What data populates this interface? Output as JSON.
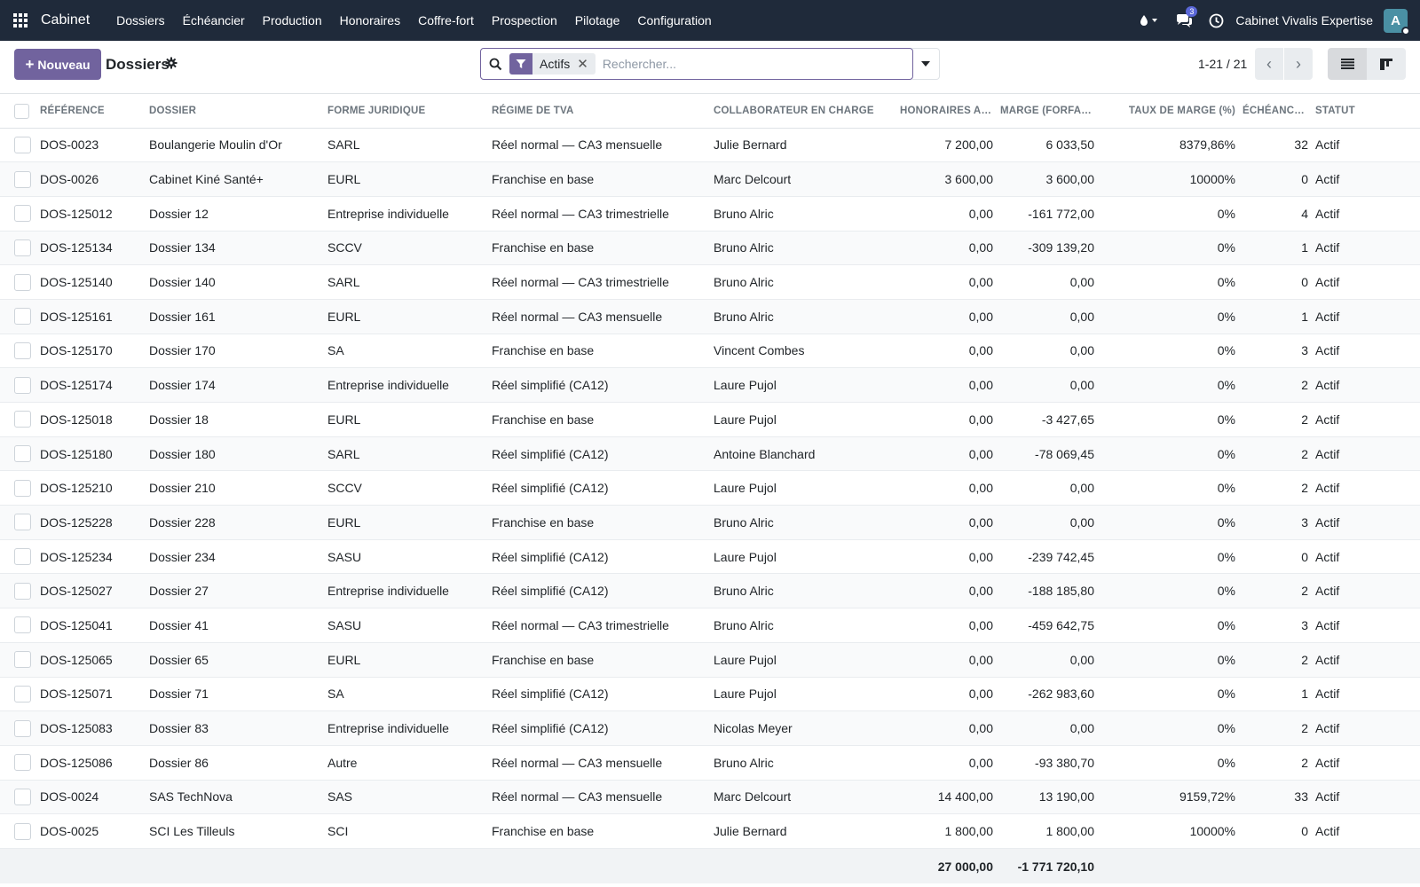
{
  "navbar": {
    "brand": "Cabinet",
    "menu": [
      "Dossiers",
      "Échéancier",
      "Production",
      "Honoraires",
      "Coffre-fort",
      "Prospection",
      "Pilotage",
      "Configuration"
    ],
    "messages_count": "3",
    "company": "Cabinet Vivalis Expertise",
    "avatar_letter": "A"
  },
  "control": {
    "new_label": "Nouveau",
    "title": "Dossiers",
    "facet_label": "Actifs",
    "search_placeholder": "Rechercher...",
    "pager": "1-21 / 21"
  },
  "table": {
    "headers": {
      "ref": "Référence",
      "dossier": "Dossier",
      "forme": "Forme juridique",
      "regime": "Régime de TVA",
      "collab": "Collaborateur en charge",
      "honoraires": "Honoraires an...",
      "marge": "Marge (forfait...",
      "taux": "Taux de marge (%)",
      "echeances": "Échéance...",
      "statut": "Statut"
    },
    "rows": [
      {
        "ref": "DOS-0023",
        "dossier": "Boulangerie Moulin d'Or",
        "forme": "SARL",
        "regime": "Réel normal — CA3 mensuelle",
        "collab": "Julie Bernard",
        "honoraires": "7 200,00",
        "marge": "6 033,50",
        "taux": "8379,86%",
        "echeances": "32",
        "statut": "Actif"
      },
      {
        "ref": "DOS-0026",
        "dossier": "Cabinet Kiné Santé+",
        "forme": "EURL",
        "regime": "Franchise en base",
        "collab": "Marc Delcourt",
        "honoraires": "3 600,00",
        "marge": "3 600,00",
        "taux": "10000%",
        "echeances": "0",
        "statut": "Actif"
      },
      {
        "ref": "DOS-125012",
        "dossier": "Dossier 12",
        "forme": "Entreprise individuelle",
        "regime": "Réel normal — CA3 trimestrielle",
        "collab": "Bruno Alric",
        "honoraires": "0,00",
        "marge": "-161 772,00",
        "taux": "0%",
        "echeances": "4",
        "statut": "Actif"
      },
      {
        "ref": "DOS-125134",
        "dossier": "Dossier 134",
        "forme": "SCCV",
        "regime": "Franchise en base",
        "collab": "Bruno Alric",
        "honoraires": "0,00",
        "marge": "-309 139,20",
        "taux": "0%",
        "echeances": "1",
        "statut": "Actif"
      },
      {
        "ref": "DOS-125140",
        "dossier": "Dossier 140",
        "forme": "SARL",
        "regime": "Réel normal — CA3 trimestrielle",
        "collab": "Bruno Alric",
        "honoraires": "0,00",
        "marge": "0,00",
        "taux": "0%",
        "echeances": "0",
        "statut": "Actif"
      },
      {
        "ref": "DOS-125161",
        "dossier": "Dossier 161",
        "forme": "EURL",
        "regime": "Réel normal — CA3 mensuelle",
        "collab": "Bruno Alric",
        "honoraires": "0,00",
        "marge": "0,00",
        "taux": "0%",
        "echeances": "1",
        "statut": "Actif"
      },
      {
        "ref": "DOS-125170",
        "dossier": "Dossier 170",
        "forme": "SA",
        "regime": "Franchise en base",
        "collab": "Vincent Combes",
        "honoraires": "0,00",
        "marge": "0,00",
        "taux": "0%",
        "echeances": "3",
        "statut": "Actif"
      },
      {
        "ref": "DOS-125174",
        "dossier": "Dossier 174",
        "forme": "Entreprise individuelle",
        "regime": "Réel simplifié (CA12)",
        "collab": "Laure Pujol",
        "honoraires": "0,00",
        "marge": "0,00",
        "taux": "0%",
        "echeances": "2",
        "statut": "Actif"
      },
      {
        "ref": "DOS-125018",
        "dossier": "Dossier 18",
        "forme": "EURL",
        "regime": "Franchise en base",
        "collab": "Laure Pujol",
        "honoraires": "0,00",
        "marge": "-3 427,65",
        "taux": "0%",
        "echeances": "2",
        "statut": "Actif"
      },
      {
        "ref": "DOS-125180",
        "dossier": "Dossier 180",
        "forme": "SARL",
        "regime": "Réel simplifié (CA12)",
        "collab": "Antoine Blanchard",
        "honoraires": "0,00",
        "marge": "-78 069,45",
        "taux": "0%",
        "echeances": "2",
        "statut": "Actif"
      },
      {
        "ref": "DOS-125210",
        "dossier": "Dossier 210",
        "forme": "SCCV",
        "regime": "Réel simplifié (CA12)",
        "collab": "Laure Pujol",
        "honoraires": "0,00",
        "marge": "0,00",
        "taux": "0%",
        "echeances": "2",
        "statut": "Actif"
      },
      {
        "ref": "DOS-125228",
        "dossier": "Dossier 228",
        "forme": "EURL",
        "regime": "Franchise en base",
        "collab": "Bruno Alric",
        "honoraires": "0,00",
        "marge": "0,00",
        "taux": "0%",
        "echeances": "3",
        "statut": "Actif"
      },
      {
        "ref": "DOS-125234",
        "dossier": "Dossier 234",
        "forme": "SASU",
        "regime": "Réel simplifié (CA12)",
        "collab": "Laure Pujol",
        "honoraires": "0,00",
        "marge": "-239 742,45",
        "taux": "0%",
        "echeances": "0",
        "statut": "Actif"
      },
      {
        "ref": "DOS-125027",
        "dossier": "Dossier 27",
        "forme": "Entreprise individuelle",
        "regime": "Réel simplifié (CA12)",
        "collab": "Bruno Alric",
        "honoraires": "0,00",
        "marge": "-188 185,80",
        "taux": "0%",
        "echeances": "2",
        "statut": "Actif"
      },
      {
        "ref": "DOS-125041",
        "dossier": "Dossier 41",
        "forme": "SASU",
        "regime": "Réel normal — CA3 trimestrielle",
        "collab": "Bruno Alric",
        "honoraires": "0,00",
        "marge": "-459 642,75",
        "taux": "0%",
        "echeances": "3",
        "statut": "Actif"
      },
      {
        "ref": "DOS-125065",
        "dossier": "Dossier 65",
        "forme": "EURL",
        "regime": "Franchise en base",
        "collab": "Laure Pujol",
        "honoraires": "0,00",
        "marge": "0,00",
        "taux": "0%",
        "echeances": "2",
        "statut": "Actif"
      },
      {
        "ref": "DOS-125071",
        "dossier": "Dossier 71",
        "forme": "SA",
        "regime": "Réel simplifié (CA12)",
        "collab": "Laure Pujol",
        "honoraires": "0,00",
        "marge": "-262 983,60",
        "taux": "0%",
        "echeances": "1",
        "statut": "Actif"
      },
      {
        "ref": "DOS-125083",
        "dossier": "Dossier 83",
        "forme": "Entreprise individuelle",
        "regime": "Réel simplifié (CA12)",
        "collab": "Nicolas Meyer",
        "honoraires": "0,00",
        "marge": "0,00",
        "taux": "0%",
        "echeances": "2",
        "statut": "Actif"
      },
      {
        "ref": "DOS-125086",
        "dossier": "Dossier 86",
        "forme": "Autre",
        "regime": "Réel normal — CA3 mensuelle",
        "collab": "Bruno Alric",
        "honoraires": "0,00",
        "marge": "-93 380,70",
        "taux": "0%",
        "echeances": "2",
        "statut": "Actif"
      },
      {
        "ref": "DOS-0024",
        "dossier": "SAS TechNova",
        "forme": "SAS",
        "regime": "Réel normal — CA3 mensuelle",
        "collab": "Marc Delcourt",
        "honoraires": "14 400,00",
        "marge": "13 190,00",
        "taux": "9159,72%",
        "echeances": "33",
        "statut": "Actif"
      },
      {
        "ref": "DOS-0025",
        "dossier": "SCI Les Tilleuls",
        "forme": "SCI",
        "regime": "Franchise en base",
        "collab": "Julie Bernard",
        "honoraires": "1 800,00",
        "marge": "1 800,00",
        "taux": "10000%",
        "echeances": "0",
        "statut": "Actif"
      }
    ],
    "totals": {
      "honoraires": "27 000,00",
      "marge": "-1 771 720,10"
    }
  },
  "colors": {
    "navbar_bg": "#1f2a3a",
    "primary": "#71639e",
    "accent_badge": "#5a67d8"
  }
}
